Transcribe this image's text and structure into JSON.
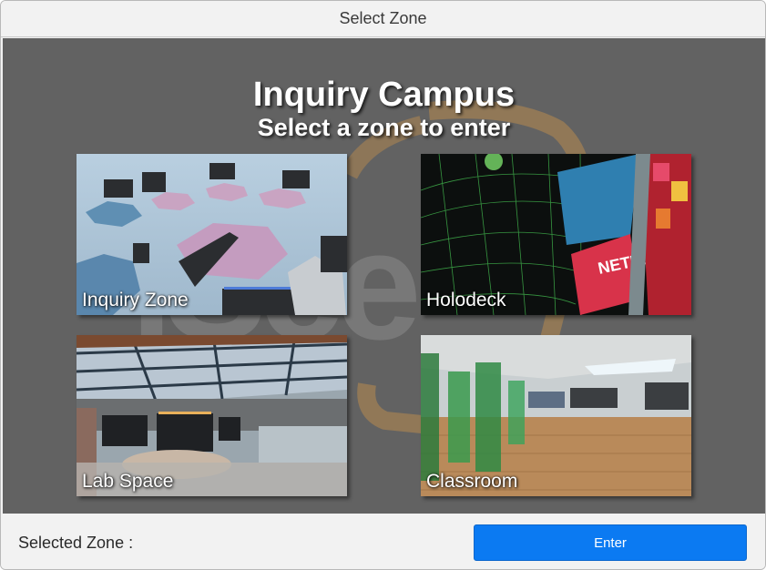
{
  "window": {
    "title": "Select Zone"
  },
  "header": {
    "title": "Inquiry Campus",
    "subtitle": "Select a zone to enter",
    "watermark_logo_text": "iSee"
  },
  "zones": [
    {
      "label": "Inquiry Zone",
      "thumbnail": "floating-platforms-scene"
    },
    {
      "label": "Holodeck",
      "thumbnail": "grid-dome-billboards-scene"
    },
    {
      "label": "Lab Space",
      "thumbnail": "warehouse-stage-scene"
    },
    {
      "label": "Classroom",
      "thumbnail": "green-pillars-room-scene"
    }
  ],
  "footer": {
    "selected_label": "Selected Zone :",
    "selected_value": "",
    "enter_label": "Enter"
  },
  "colors": {
    "stage_background": "#626262",
    "watermark_orange": "#c8863a",
    "enter_button": "#0b7af2"
  }
}
